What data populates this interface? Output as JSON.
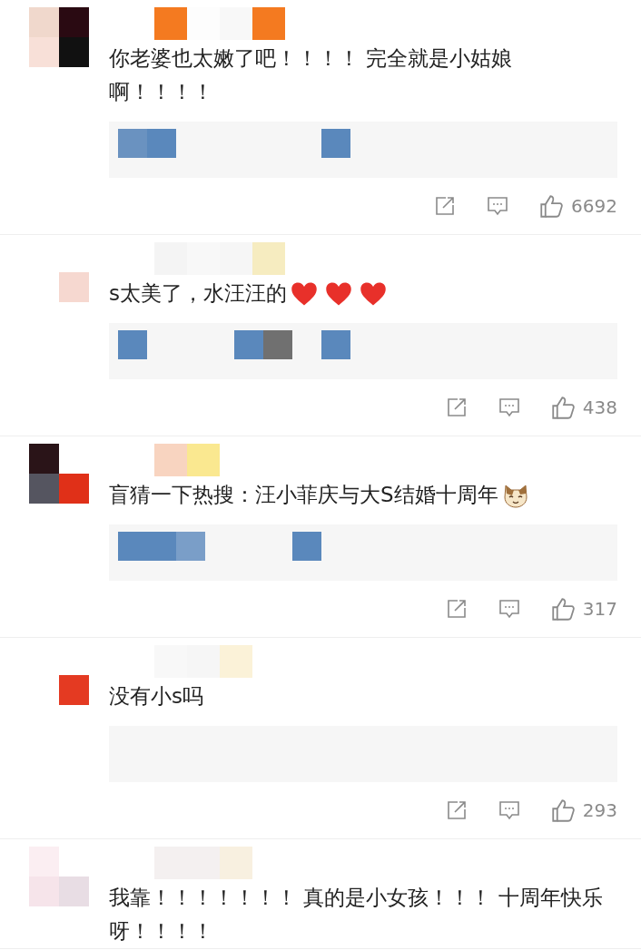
{
  "comments": [
    {
      "text": "你老婆也太嫩了吧！！！！ 完全就是小姑娘啊！！！！",
      "likes": "6692"
    },
    {
      "text": "s太美了，水汪汪的",
      "emojis": [
        {
          "kind": "heart"
        },
        {
          "kind": "heart"
        },
        {
          "kind": "heart"
        }
      ],
      "likes": "438"
    },
    {
      "text": "盲猜一下热搜：汪小菲庆与大S结婚十周年",
      "emojis": [
        {
          "kind": "cat"
        }
      ],
      "likes": "317"
    },
    {
      "text": "没有小s吗",
      "likes": "293"
    },
    {
      "text": "我靠！！！！！！！ 真的是小女孩！！！ 十周年快乐呀！！！！"
    }
  ]
}
